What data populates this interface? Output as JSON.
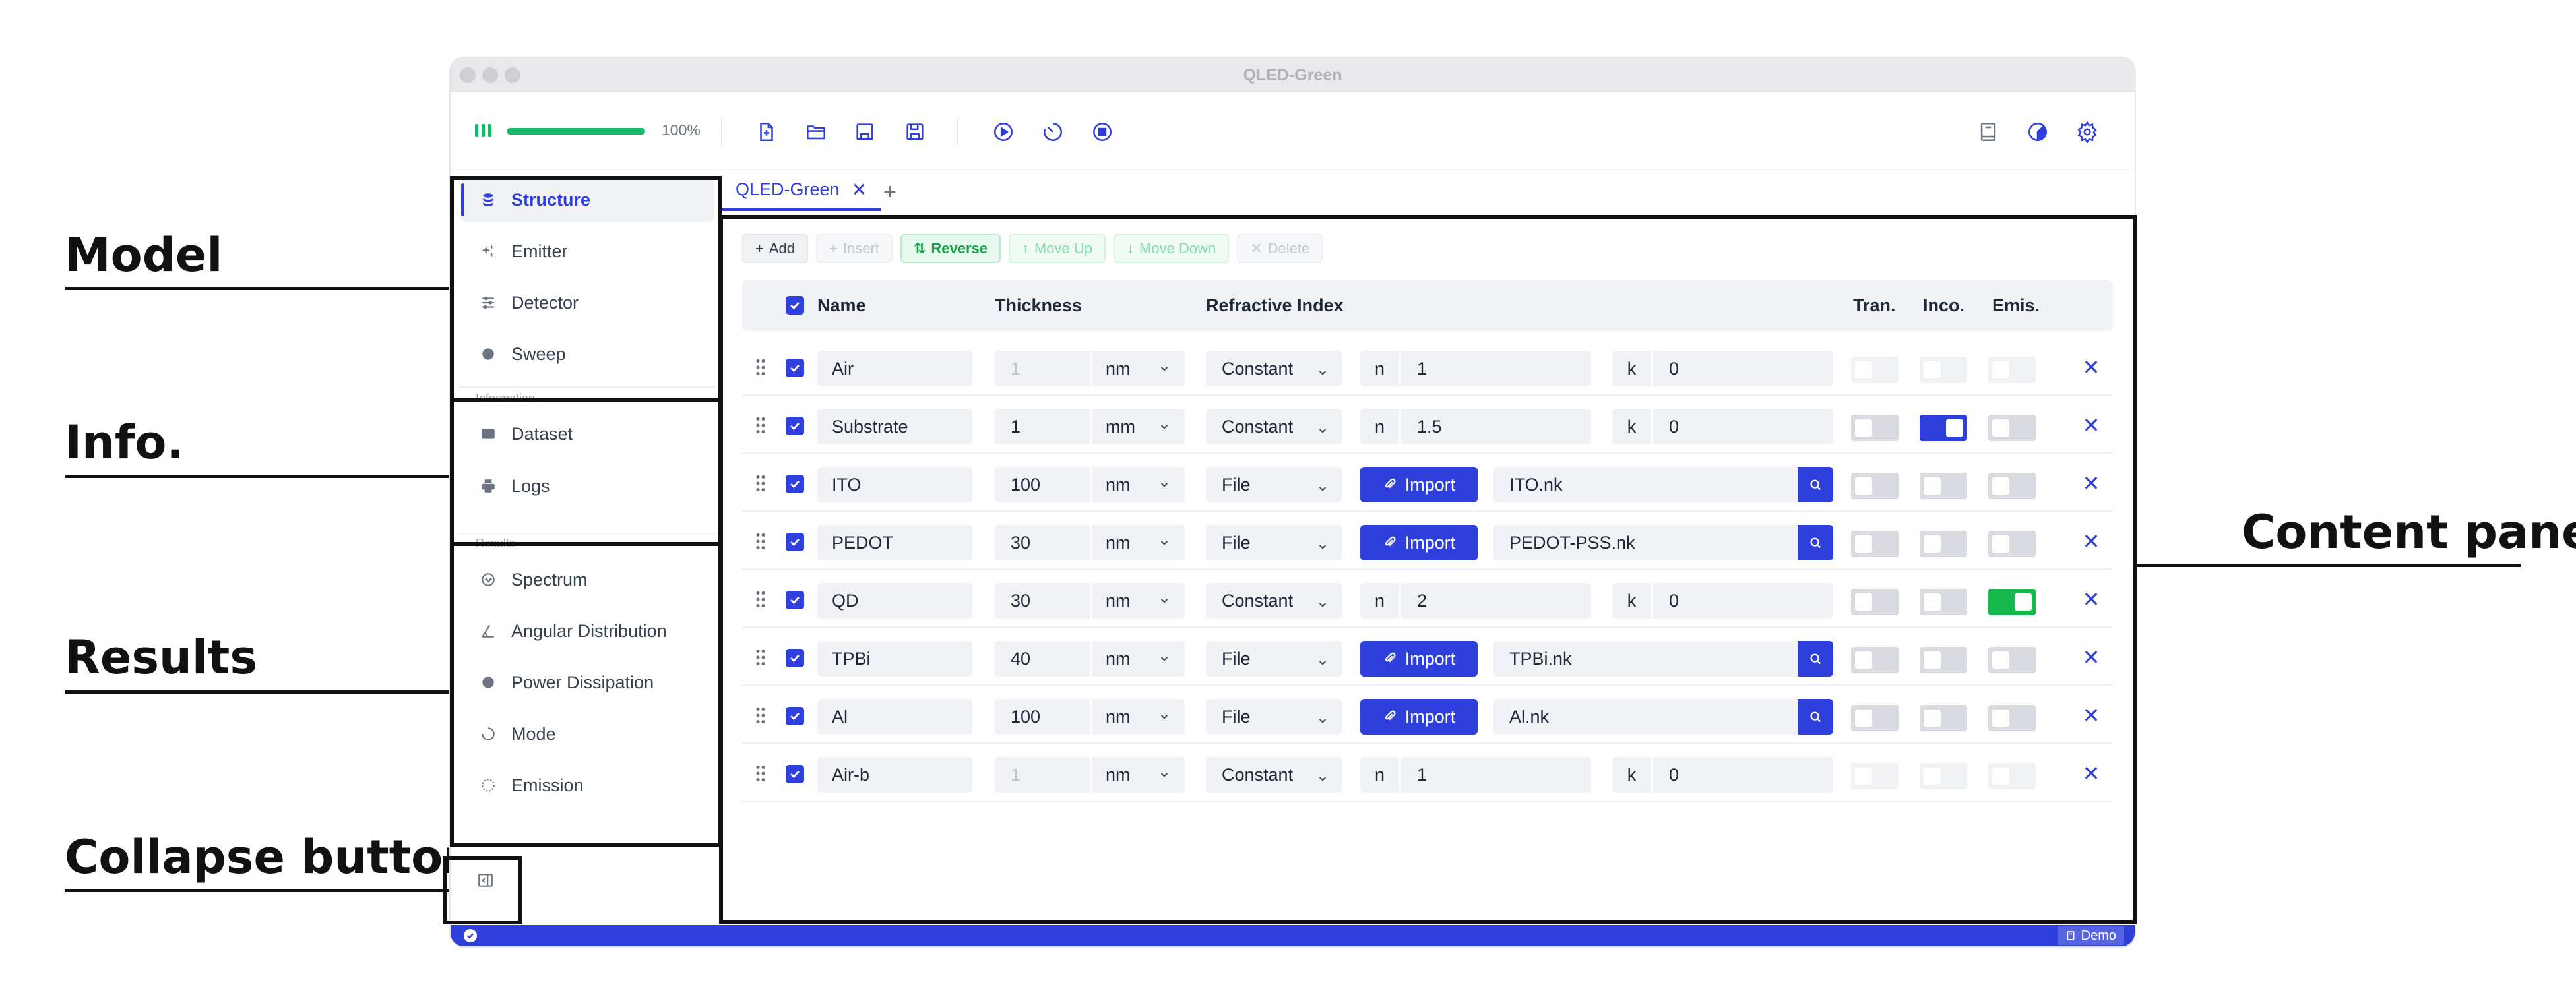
{
  "annotations": {
    "model": "Model",
    "info": "Info.",
    "results": "Results",
    "collapse": "Collapse button",
    "content": "Content pane"
  },
  "window": {
    "title": "QLED-Green"
  },
  "toolbar": {
    "progress_percent": 100,
    "progress_text": "100%",
    "icons": [
      "new-file-icon",
      "open-folder-icon",
      "save-icon",
      "save-as-icon",
      "run-icon",
      "timer-icon",
      "stop-icon",
      "book-icon",
      "theme-icon",
      "settings-icon"
    ]
  },
  "sidebar": {
    "model_items": [
      {
        "label": "Structure",
        "icon": "layers-icon",
        "active": true
      },
      {
        "label": "Emitter",
        "icon": "sparkle-icon"
      },
      {
        "label": "Detector",
        "icon": "sliders-icon"
      },
      {
        "label": "Sweep",
        "icon": "pie-icon"
      }
    ],
    "info_section": "Information",
    "info_items": [
      {
        "label": "Dataset",
        "icon": "dataset-icon"
      },
      {
        "label": "Logs",
        "icon": "printer-icon"
      }
    ],
    "results_section": "Results",
    "results_items": [
      {
        "label": "Spectrum",
        "icon": "spectrum-icon"
      },
      {
        "label": "Angular Distribution",
        "icon": "angle-icon"
      },
      {
        "label": "Power Dissipation",
        "icon": "gauge-icon"
      },
      {
        "label": "Mode",
        "icon": "loader-icon"
      },
      {
        "label": "Emission",
        "icon": "sun-icon"
      }
    ]
  },
  "tabs": [
    {
      "label": "QLED-Green",
      "close": "✕"
    }
  ],
  "tab_add": "+",
  "actions": {
    "add": "Add",
    "insert": "Insert",
    "reverse": "Reverse",
    "move_up": "Move Up",
    "move_down": "Move Down",
    "delete": "Delete"
  },
  "table": {
    "headers": {
      "name": "Name",
      "thickness": "Thickness",
      "refractive_index": "Refractive Index",
      "tran": "Tran.",
      "inco": "Inco.",
      "emis": "Emis."
    },
    "import_label": "Import",
    "rows": [
      {
        "name": "Air",
        "thickness": "1",
        "unit": "nm",
        "mode": "Constant",
        "n": "1",
        "k": "0",
        "tran": false,
        "inco": false,
        "emis": false,
        "disabled": true
      },
      {
        "name": "Substrate",
        "thickness": "1",
        "unit": "mm",
        "mode": "Constant",
        "n": "1.5",
        "k": "0",
        "tran": false,
        "inco": true,
        "emis": false
      },
      {
        "name": "ITO",
        "thickness": "100",
        "unit": "nm",
        "mode": "File",
        "file": "ITO.nk",
        "tran": false,
        "inco": false,
        "emis": false
      },
      {
        "name": "PEDOT",
        "thickness": "30",
        "unit": "nm",
        "mode": "File",
        "file": "PEDOT-PSS.nk",
        "tran": false,
        "inco": false,
        "emis": false
      },
      {
        "name": "QD",
        "thickness": "30",
        "unit": "nm",
        "mode": "Constant",
        "n": "2",
        "k": "0",
        "tran": false,
        "inco": false,
        "emis": true
      },
      {
        "name": "TPBi",
        "thickness": "40",
        "unit": "nm",
        "mode": "File",
        "file": "TPBi.nk",
        "tran": false,
        "inco": false,
        "emis": false
      },
      {
        "name": "Al",
        "thickness": "100",
        "unit": "nm",
        "mode": "File",
        "file": "Al.nk",
        "tran": false,
        "inco": false,
        "emis": false
      },
      {
        "name": "Air-b",
        "thickness": "1",
        "unit": "nm",
        "mode": "Constant",
        "n": "1",
        "k": "0",
        "tran": false,
        "inco": false,
        "emis": false,
        "disabled": true
      }
    ]
  },
  "statusbar": {
    "badge": "Demo"
  },
  "colors": {
    "accent": "#2f3fdc",
    "success": "#16b84c",
    "panel": "#f1f2f5"
  }
}
